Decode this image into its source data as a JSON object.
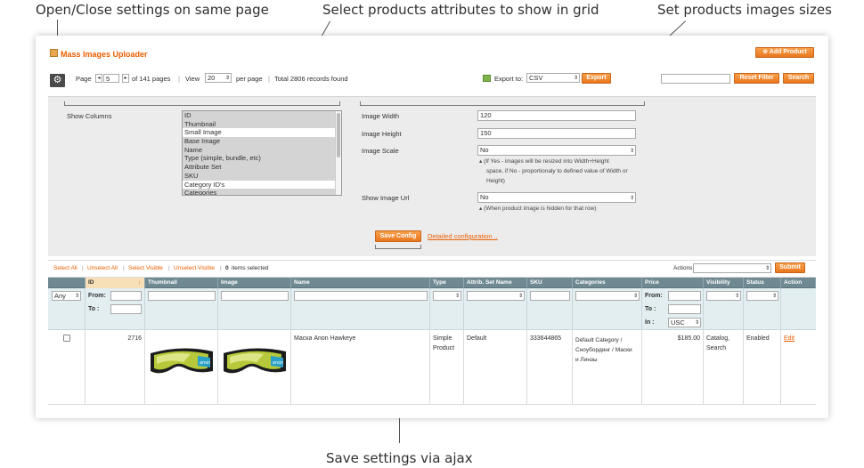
{
  "callouts": {
    "open_close": "Open/Close settings on same page",
    "select_attrs": "Select products attributes to show in grid",
    "image_sizes": "Set products images sizes",
    "save_ajax": "Save settings via ajax"
  },
  "header": {
    "title": "Mass Images Uploader",
    "add_product": "Add Product"
  },
  "pager": {
    "page_label": "Page",
    "page_value": "5",
    "of_pages": "of 141 pages",
    "view_label": "View",
    "view_value": "20",
    "per_page": "per page",
    "total": "Total 2806 records found",
    "export_label": "Export to:",
    "export_value": "CSV",
    "export_button": "Export",
    "reset_filter": "Reset Filter",
    "search": "Search"
  },
  "settings": {
    "show_columns_label": "Show Columns",
    "columns": [
      {
        "label": "ID",
        "selected": true
      },
      {
        "label": "Thumbnail",
        "selected": true
      },
      {
        "label": "Small Image",
        "selected": false
      },
      {
        "label": "Base Image",
        "selected": true
      },
      {
        "label": "Name",
        "selected": true
      },
      {
        "label": "Type (simple, bundle, etc)",
        "selected": true
      },
      {
        "label": "Attribute Set",
        "selected": true
      },
      {
        "label": "SKU",
        "selected": true
      },
      {
        "label": "Category ID's",
        "selected": false
      },
      {
        "label": "Categories",
        "selected": true
      }
    ],
    "image_width_label": "Image Width",
    "image_width_value": "120",
    "image_height_label": "Image Height",
    "image_height_value": "150",
    "image_scale_label": "Image Scale",
    "image_scale_value": "No",
    "image_scale_note_1": "(If Yes - images will be resized into Width+Height",
    "image_scale_note_2": "space, if No - proportionaly to defined value of Width or",
    "image_scale_note_3": "Height)",
    "show_url_label": "Show Image Url",
    "show_url_value": "No",
    "show_url_note": "(When product image is hidden for that row)",
    "save_config": "Save Config",
    "detailed_config": "Detailed configuration .."
  },
  "massaction": {
    "select_all": "Select All",
    "unselect_all": "Unselect All",
    "select_visible": "Select Visible",
    "unselect_visible": "Unselect Visible",
    "items_count": "0",
    "items_selected": "items selected",
    "actions_label": "Actions",
    "submit": "Submit"
  },
  "grid": {
    "columns": [
      "",
      "ID",
      "Thumbnail",
      "Image",
      "Name",
      "Type",
      "Attrib. Set Name",
      "SKU",
      "Categories",
      "Price",
      "Visibility",
      "Status",
      "Action"
    ],
    "sort_arrow": "↓",
    "filters": {
      "any": "Any",
      "from": "From:",
      "to": "To :",
      "in": "In :",
      "currency": "USC"
    },
    "row": {
      "id": "2716",
      "name": "Маска Anon Hawkeye",
      "type_1": "Simple",
      "type_2": "Product",
      "attrib_set": "Default",
      "sku": "333644865",
      "categories_1": "Default Category /",
      "categories_2": "Сноубординг / Маски",
      "categories_3": "и Линзы",
      "price": "$185.00",
      "visibility_1": "Catalog,",
      "visibility_2": "Search",
      "status": "Enabled",
      "action": "Edit"
    }
  },
  "icons": {
    "gear": "gear-icon",
    "box": "box-icon",
    "plus": "plus-icon",
    "export": "export-icon",
    "arrow_left": "arrow-left-icon",
    "arrow_right": "arrow-right-icon",
    "goggles": "ski-goggles-image"
  }
}
